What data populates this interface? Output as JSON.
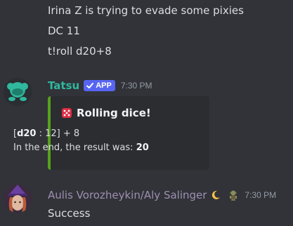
{
  "messages": {
    "line1": "Irina Z is trying to evade some pixies",
    "line2": "DC 11",
    "line3": "t!roll d20+8"
  },
  "tatsu": {
    "name": "Tatsu",
    "badge": "APP",
    "time": "7:30 PM",
    "avatar_icon": "tatsu-avatar",
    "embed": {
      "title": "Rolling dice!",
      "die_icon": "red-die-icon",
      "roll_prefix": "[",
      "roll_die": "d20",
      "roll_rest": " : 12] + 8",
      "result_prefix": "In the end, the result was: ",
      "result_value": "20",
      "accent_color": "#57a11b"
    }
  },
  "aulis": {
    "name": "Aulis Vorozheykin/Aly Salinger",
    "time": "7:30 PM",
    "message": "Success",
    "emoji1": "crescent-moon-icon",
    "emoji2": "goblin-icon"
  },
  "colors": {
    "background": "#313338",
    "tatsu_name": "#2fb89e",
    "aulis_name": "#9f8fb3",
    "app_badge": "#5865f2"
  }
}
